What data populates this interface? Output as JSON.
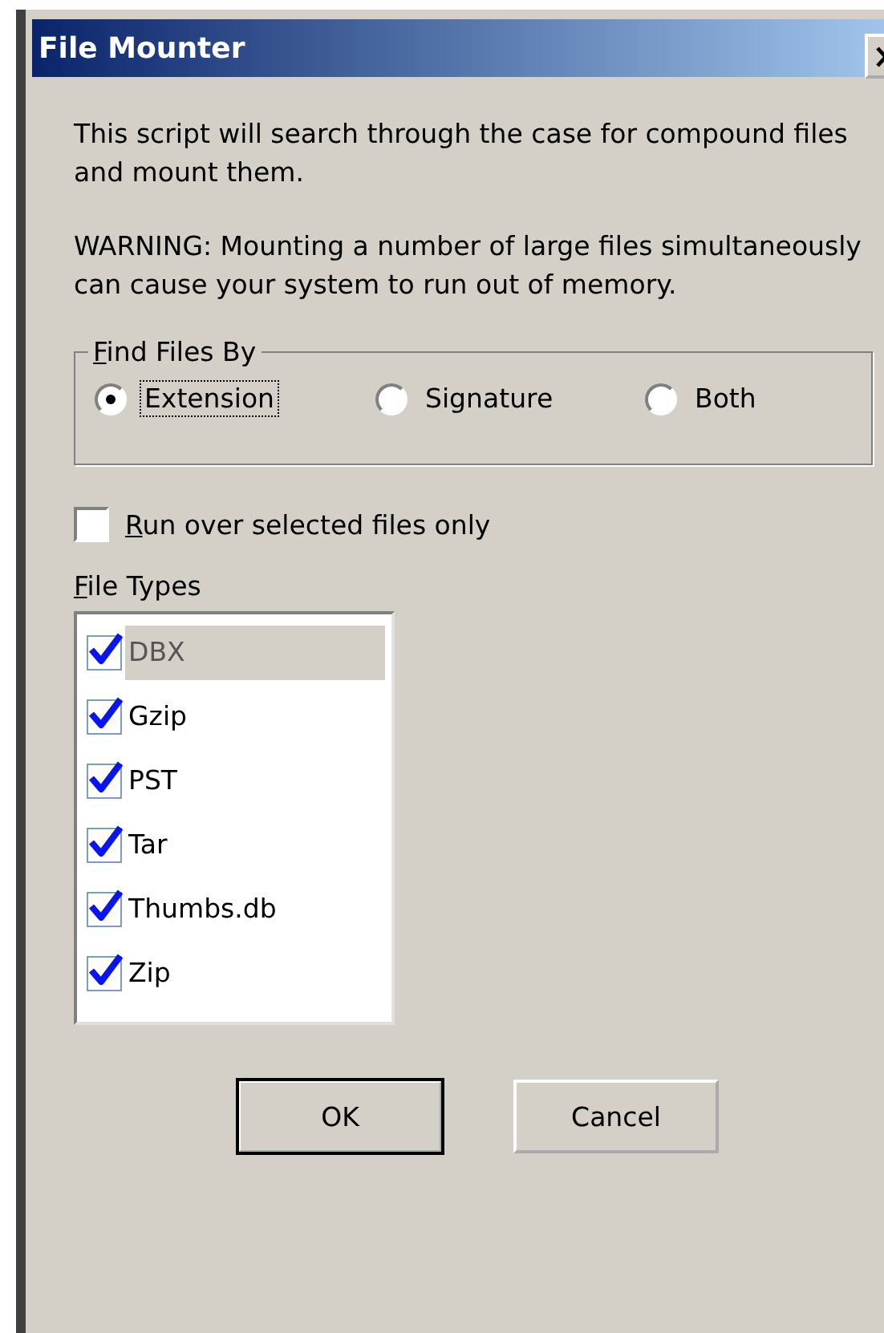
{
  "window": {
    "title": "File Mounter"
  },
  "intro": "This script will search through the case for compound files and mount them.",
  "warning": "WARNING: Mounting a number of large files simultaneously can cause your system to run out of memory.",
  "find_files_by": {
    "label": "Find Files By",
    "options": [
      {
        "label": "Extension",
        "selected": true
      },
      {
        "label": "Signature",
        "selected": false
      },
      {
        "label": "Both",
        "selected": false
      }
    ]
  },
  "run_selected_only": {
    "label": "Run over selected files only",
    "checked": false
  },
  "file_types": {
    "label": "File Types",
    "items": [
      {
        "label": "DBX",
        "checked": true,
        "selected": true
      },
      {
        "label": "Gzip",
        "checked": true,
        "selected": false
      },
      {
        "label": "PST",
        "checked": true,
        "selected": false
      },
      {
        "label": "Tar",
        "checked": true,
        "selected": false
      },
      {
        "label": "Thumbs.db",
        "checked": true,
        "selected": false
      },
      {
        "label": "Zip",
        "checked": true,
        "selected": false
      }
    ]
  },
  "buttons": [
    {
      "label": "OK",
      "default": true
    },
    {
      "label": "Cancel",
      "default": false
    }
  ]
}
